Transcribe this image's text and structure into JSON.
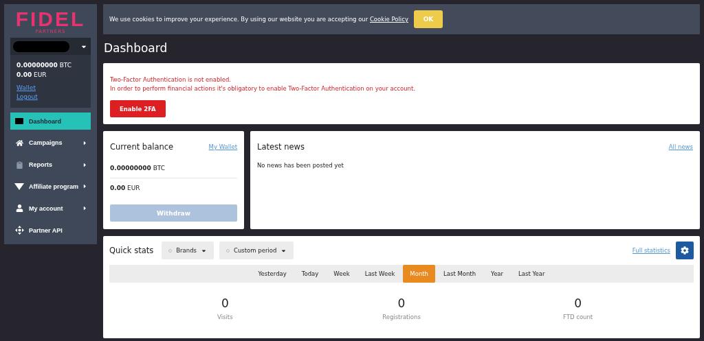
{
  "logo": {
    "title": "FIDEL",
    "subtitle": "PARTNERS"
  },
  "account": {
    "balances": [
      {
        "amount": "0.00000000",
        "currency": "BTC"
      },
      {
        "amount": "0.00",
        "currency": "EUR"
      }
    ],
    "links": [
      "Wallet",
      "Logout"
    ]
  },
  "sidebar": {
    "items": [
      {
        "label": "Dashboard",
        "selected": true,
        "has_submenu": false
      },
      {
        "label": "Campaigns",
        "selected": false,
        "has_submenu": true
      },
      {
        "label": "Reports",
        "selected": false,
        "has_submenu": true
      },
      {
        "label": "Affiliate program",
        "selected": false,
        "has_submenu": true
      },
      {
        "label": "My account",
        "selected": false,
        "has_submenu": true
      },
      {
        "label": "Partner API",
        "selected": false,
        "has_submenu": false
      }
    ]
  },
  "cookie_bar": {
    "text": "We use cookies to improve your experience. By using our website you are accepting our",
    "link": "Cookie Policy",
    "button": "OK"
  },
  "page_title": "Dashboard",
  "alert": {
    "lines": [
      "Two-Factor Authentication is not enabled.",
      "In order to perform financial actions it's obligatory to enable Two-Factor Authentication on your account."
    ],
    "button": "Enable 2FA"
  },
  "balance_card": {
    "title": "Current balance",
    "link": "My Wallet",
    "balances": [
      {
        "amount": "0.00000000",
        "currency": "BTC"
      },
      {
        "amount": "0.00",
        "currency": "EUR"
      }
    ],
    "button": {
      "label": "Withdraw",
      "disabled": true
    }
  },
  "news_card": {
    "title": "Latest news",
    "link": "All news",
    "empty_text": "No news has been posted yet"
  },
  "quick_stats": {
    "title": "Quick stats",
    "filters": [
      "Brands",
      "Custom period"
    ],
    "link": "Full statistics",
    "periods": [
      {
        "label": "Yesterday",
        "selected": false
      },
      {
        "label": "Today",
        "selected": false
      },
      {
        "label": "Week",
        "selected": false
      },
      {
        "label": "Last Week",
        "selected": false
      },
      {
        "label": "Month",
        "selected": true
      },
      {
        "label": "Last Month",
        "selected": false
      },
      {
        "label": "Year",
        "selected": false
      },
      {
        "label": "Last Year",
        "selected": false
      }
    ],
    "stats": [
      {
        "value": "0",
        "label": "Visits"
      },
      {
        "value": "0",
        "label": "Registrations"
      },
      {
        "value": "0",
        "label": "FTD count"
      }
    ]
  }
}
